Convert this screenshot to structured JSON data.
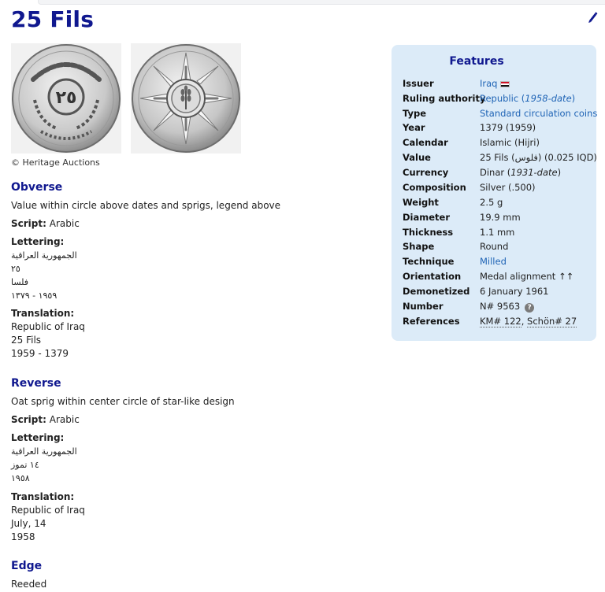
{
  "page": {
    "title": "25 Fils",
    "image_credit": "© Heritage Auctions"
  },
  "obverse": {
    "heading": "Obverse",
    "description": "Value within circle above dates and sprigs, legend above",
    "script_label": "Script:",
    "script_value": "Arabic",
    "lettering_label": "Lettering:",
    "lettering": [
      "الجمهورية العراقية",
      "٢٥",
      "فلسا",
      "١٩٥٩ - ١٣٧٩"
    ],
    "translation_label": "Translation:",
    "translation": [
      "Republic of Iraq",
      "25 Fils",
      "1959 - 1379"
    ],
    "coin_center_text": "٢٥"
  },
  "reverse": {
    "heading": "Reverse",
    "description": "Oat sprig within center circle of star-like design",
    "script_label": "Script:",
    "script_value": "Arabic",
    "lettering_label": "Lettering:",
    "lettering": [
      "الجمهورية العراقية",
      "١٤ تموز",
      "١٩٥٨"
    ],
    "translation_label": "Translation:",
    "translation": [
      "Republic of Iraq",
      "July, 14",
      "1958"
    ]
  },
  "edge": {
    "heading": "Edge",
    "value": "Reeded"
  },
  "features": {
    "title": "Features",
    "rows": [
      {
        "key": "Issuer",
        "value": "Iraq"
      },
      {
        "key": "Ruling authority",
        "value": "Republic (",
        "value_italic": "1958-date",
        "value_after": ")"
      },
      {
        "key": "Type",
        "value": "Standard circulation coins"
      },
      {
        "key": "Year",
        "value": "1379 (1959)"
      },
      {
        "key": "Calendar",
        "value": "Islamic (Hijri)"
      },
      {
        "key": "Value",
        "value": "25 Fils (فلوس) (0.025 IQD)"
      },
      {
        "key": "Currency",
        "value": "Dinar (",
        "value_italic": "1931-date",
        "value_after": ")"
      },
      {
        "key": "Composition",
        "value": "Silver (.500)"
      },
      {
        "key": "Weight",
        "value": "2.5 g"
      },
      {
        "key": "Diameter",
        "value": "19.9 mm"
      },
      {
        "key": "Thickness",
        "value": "1.1 mm"
      },
      {
        "key": "Shape",
        "value": "Round"
      },
      {
        "key": "Technique",
        "value": "Milled"
      },
      {
        "key": "Orientation",
        "value": "Medal alignment ↑↑"
      },
      {
        "key": "Demonetized",
        "value": "6 January 1961"
      },
      {
        "key": "Number",
        "value": "N# 9563"
      },
      {
        "key": "References",
        "value": "KM# 122",
        "value_sep": ", ",
        "value_2": "Schön# 27"
      }
    ]
  },
  "colors": {
    "heading": "#10188f",
    "link": "#1e63b5",
    "features_bg": "#dcebf8"
  },
  "icons": {
    "edit": "edit-pencil-icon",
    "help": "question-help-icon",
    "flag": "iraq-flag-icon"
  }
}
